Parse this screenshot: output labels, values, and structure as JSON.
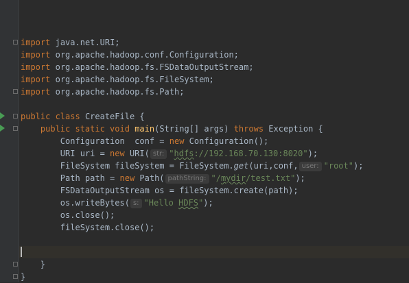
{
  "code": {
    "imports": [
      {
        "keyword": "import",
        "path": "java.net.URI;"
      },
      {
        "keyword": "import",
        "path": "org.apache.hadoop.conf.Configuration;"
      },
      {
        "keyword": "import",
        "path": "org.apache.hadoop.fs.FSDataOutputStream;"
      },
      {
        "keyword": "import",
        "path": "org.apache.hadoop.fs.FileSystem;"
      },
      {
        "keyword": "import",
        "path": "org.apache.hadoop.fs.Path;"
      }
    ],
    "class_decl": {
      "mods": "public class",
      "name": "CreateFile {"
    },
    "main_decl": {
      "mods": "public static void",
      "name": "main",
      "params": "(String[] args)",
      "throws": "throws",
      "exc": "Exception {"
    },
    "l_conf": {
      "a": "Configuration  conf = ",
      "kw": "new",
      "b": " Configuration();"
    },
    "l_uri": {
      "a": "URI uri = ",
      "kw": "new",
      "b": " URI(",
      "hint": "str:",
      "s1": "\"",
      "s2": "hdfs",
      "s3": "://192.168.70.130:8020\"",
      "c": ");"
    },
    "l_fs": {
      "a": "FileSystem fileSystem = FileSystem.",
      "m": "get",
      "b": "(uri,conf,",
      "hint": "user:",
      "s": "\"root\"",
      "c": ");"
    },
    "l_path": {
      "a": "Path path = ",
      "kw": "new",
      "b": " Path(",
      "hint": "pathString:",
      "s1": "\"/",
      "s2": "mydir",
      "s3": "/test.txt\"",
      "c": ");"
    },
    "l_os": {
      "a": "FSDataOutputStream os = fileSystem.create(path);"
    },
    "l_write": {
      "a": "os.writeBytes(",
      "hint": "s:",
      "s1": "\"Hello ",
      "s2": "HDFS",
      "s3": "\"",
      "c": ");"
    },
    "l_close": {
      "a": "os.close();"
    },
    "l_fsclose": {
      "a": "fileSystem.close();"
    },
    "close_method": "}",
    "close_class": "}"
  },
  "colors": {
    "background": "#2b2b2b",
    "keyword": "#cc7832",
    "string": "#6a8759",
    "method": "#ffc66d",
    "text": "#a9b7c6"
  },
  "icons": [
    "run-arrow-icon",
    "fold-icon"
  ]
}
